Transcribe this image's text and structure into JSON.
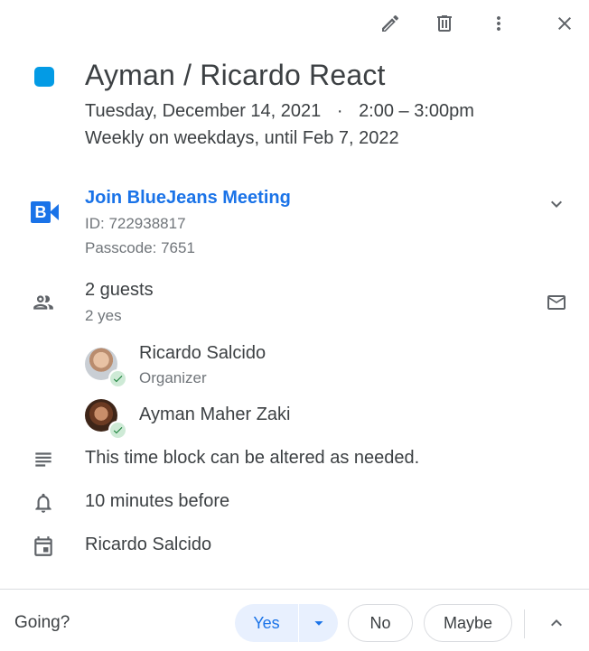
{
  "toolbar": {
    "edit_icon": "pencil-icon",
    "delete_icon": "trash-icon",
    "more_icon": "more-vert-icon",
    "close_icon": "close-icon"
  },
  "event": {
    "color": "#039be5",
    "title": "Ayman / Ricardo React",
    "date": "Tuesday, December 14, 2021",
    "separator": "·",
    "time": "2:00 – 3:00pm",
    "recurrence": "Weekly on weekdays, until Feb 7, 2022"
  },
  "conference": {
    "logo_text": "B",
    "join_label": "Join BlueJeans Meeting",
    "id_text": "ID: 722938817",
    "passcode_text": "Passcode: 7651"
  },
  "guests": {
    "summary": "2 guests",
    "responses": "2 yes",
    "list": [
      {
        "name": "Ricardo Salcido",
        "role": "Organizer"
      },
      {
        "name": "Ayman Maher Zaki",
        "role": ""
      }
    ]
  },
  "description": "This time block can be altered as needed.",
  "reminder": "10 minutes before",
  "calendar_owner": "Ricardo Salcido",
  "rsvp": {
    "prompt": "Going?",
    "yes": "Yes",
    "no": "No",
    "maybe": "Maybe"
  },
  "colors": {
    "accent": "#1a73e8",
    "event": "#039be5",
    "yes_bg": "#e8f0fe",
    "accepted": "#188038"
  }
}
